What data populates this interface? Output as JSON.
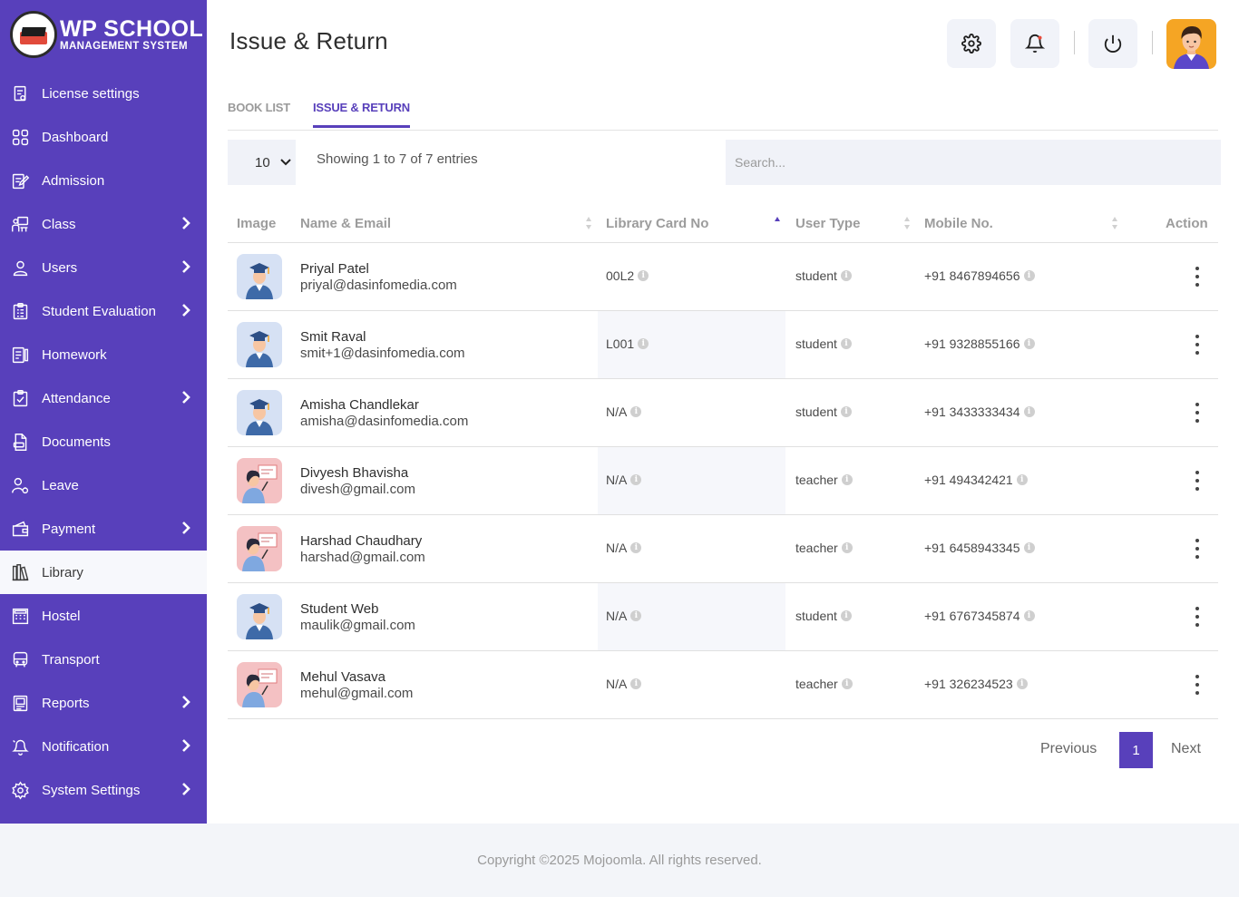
{
  "brand": {
    "title": "WP SCHOOL",
    "subtitle": "MANAGEMENT SYSTEM"
  },
  "sidebar": {
    "items": [
      {
        "label": "License settings",
        "icon": "license-icon",
        "has_submenu": false
      },
      {
        "label": "Dashboard",
        "icon": "dashboard-icon",
        "has_submenu": false
      },
      {
        "label": "Admission",
        "icon": "admission-icon",
        "has_submenu": false
      },
      {
        "label": "Class",
        "icon": "class-icon",
        "has_submenu": true
      },
      {
        "label": "Users",
        "icon": "user-icon",
        "has_submenu": true
      },
      {
        "label": "Student Evaluation",
        "icon": "evaluation-icon",
        "has_submenu": true
      },
      {
        "label": "Homework",
        "icon": "homework-icon",
        "has_submenu": false
      },
      {
        "label": "Attendance",
        "icon": "attendance-icon",
        "has_submenu": true
      },
      {
        "label": "Documents",
        "icon": "documents-icon",
        "has_submenu": false
      },
      {
        "label": "Leave",
        "icon": "leave-icon",
        "has_submenu": false
      },
      {
        "label": "Payment",
        "icon": "payment-icon",
        "has_submenu": true
      },
      {
        "label": "Library",
        "icon": "library-icon",
        "has_submenu": false,
        "active": true
      },
      {
        "label": "Hostel",
        "icon": "hostel-icon",
        "has_submenu": false
      },
      {
        "label": "Transport",
        "icon": "transport-icon",
        "has_submenu": false
      },
      {
        "label": "Reports",
        "icon": "reports-icon",
        "has_submenu": true
      },
      {
        "label": "Notification",
        "icon": "notification-icon",
        "has_submenu": true
      },
      {
        "label": "System Settings",
        "icon": "settings-icon",
        "has_submenu": true
      }
    ]
  },
  "header": {
    "title": "Issue & Return",
    "buttons": [
      "gear-icon",
      "bell-icon",
      "power-icon"
    ],
    "avatar": "user-avatar"
  },
  "tabs": [
    {
      "label": "BOOK LIST",
      "active": false
    },
    {
      "label": "ISSUE & RETURN",
      "active": true
    }
  ],
  "table_controls": {
    "page_length": "10",
    "info": "Showing 1 to 7 of 7 entries",
    "search_placeholder": "Search..."
  },
  "table": {
    "columns": [
      "Image",
      "Name & Email",
      "Library Card No",
      "User Type",
      "Mobile No.",
      "Action"
    ],
    "rows": [
      {
        "type": "student",
        "name": "Priyal Patel",
        "email": "priyal@dasinfomedia.com",
        "card": "00L2",
        "user_type": "student",
        "mobile": "+91 8467894656"
      },
      {
        "type": "student",
        "name": "Smit Raval",
        "email": "smit+1@dasinfomedia.com",
        "card": "L001",
        "user_type": "student",
        "mobile": "+91 9328855166"
      },
      {
        "type": "student",
        "name": "Amisha Chandlekar",
        "email": "amisha@dasinfomedia.com",
        "card": "N/A",
        "user_type": "student",
        "mobile": "+91 3433333434"
      },
      {
        "type": "teacher",
        "name": "Divyesh Bhavisha",
        "email": "divesh@gmail.com",
        "card": "N/A",
        "user_type": "teacher",
        "mobile": "+91 494342421"
      },
      {
        "type": "teacher",
        "name": "Harshad Chaudhary",
        "email": "harshad@gmail.com",
        "card": "N/A",
        "user_type": "teacher",
        "mobile": "+91 6458943345"
      },
      {
        "type": "student",
        "name": "Student Web",
        "email": "maulik@gmail.com",
        "card": "N/A",
        "user_type": "student",
        "mobile": "+91 6767345874"
      },
      {
        "type": "teacher",
        "name": "Mehul Vasava",
        "email": "mehul@gmail.com",
        "card": "N/A",
        "user_type": "teacher",
        "mobile": "+91 326234523"
      }
    ]
  },
  "pagination": {
    "previous": "Previous",
    "current": "1",
    "next": "Next"
  },
  "footer": {
    "text": "Copyright ©2025 Mojoomla. All rights reserved."
  },
  "colors": {
    "accent": "#5840bb",
    "student_bg": "#d6e1f4",
    "teacher_bg": "#f4c1c3"
  }
}
